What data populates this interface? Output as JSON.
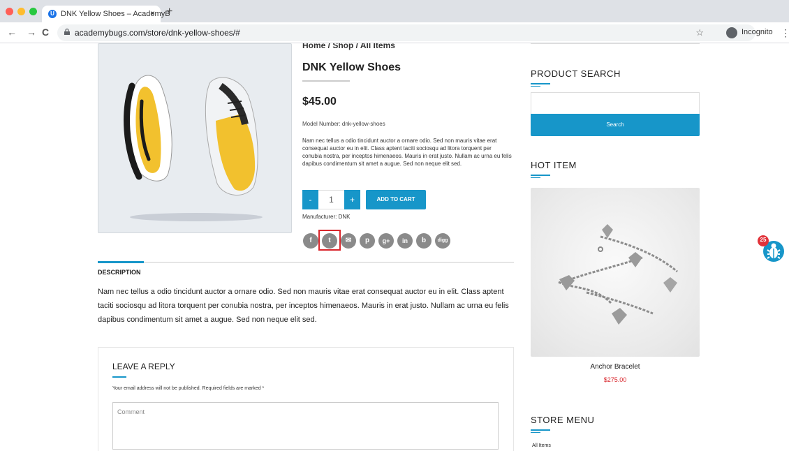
{
  "browser": {
    "tab_title": "DNK Yellow Shoes – AcademyB",
    "tab_close": "×",
    "new_tab": "+",
    "url": "academybugs.com/store/dnk-yellow-shoes/#",
    "incognito_label": "Incognito",
    "back": "←",
    "forward": "→",
    "reload": "C",
    "star": "☆",
    "menu": "⋮"
  },
  "product": {
    "breadcrumb": "Home / Shop / All Items",
    "title": "DNK Yellow Shoes",
    "price": "$45.00",
    "model": "Model Number: dnk-yellow-shoes",
    "short_description": "Nam nec tellus a odio tincidunt auctor a ornare odio. Sed non mauris vitae erat consequat auctor eu in elit. Class aptent taciti sociosqu ad litora torquent per conubia nostra, per inceptos himenaeos. Mauris in erat justo. Nullam ac urna eu felis dapibus condimentum sit amet a augue. Sed non neque elit sed.",
    "qty_minus": "-",
    "qty_value": "1",
    "qty_plus": "+",
    "add_to_cart": "ADD TO CART",
    "manufacturer": "Manufacturer: DNK",
    "share_icons": [
      {
        "name": "facebook-icon",
        "glyph": "f"
      },
      {
        "name": "twitter-icon",
        "glyph": "t"
      },
      {
        "name": "email-icon",
        "glyph": "✉"
      },
      {
        "name": "pinterest-icon",
        "glyph": "p"
      },
      {
        "name": "google-plus-icon",
        "glyph": "g+"
      },
      {
        "name": "linkedin-icon",
        "glyph": "in"
      },
      {
        "name": "buffer-icon",
        "glyph": "b"
      },
      {
        "name": "digg-icon",
        "glyph": "digg"
      }
    ]
  },
  "description": {
    "tab_label": "DESCRIPTION",
    "text": "Nam nec tellus a odio tincidunt auctor a ornare odio. Sed non mauris vitae erat consequat auctor eu in elit. Class aptent taciti sociosqu ad litora torquent per conubia nostra, per inceptos himenaeos. Mauris in erat justo. Nullam ac urna eu felis dapibus condimentum sit amet a augue. Sed non neque elit sed."
  },
  "reply": {
    "title": "LEAVE A REPLY",
    "note": "Your email address will not be published. Required fields are marked *",
    "comment_placeholder": "Comment"
  },
  "sidebar": {
    "search_title": "PRODUCT SEARCH",
    "search_button": "Search",
    "hot_title": "HOT ITEM",
    "hot_name": "Anchor Bracelet",
    "hot_price": "$275.00",
    "store_menu_title": "STORE MENU",
    "store_item": "All Items"
  },
  "bug_widget": {
    "count": "25"
  },
  "colors": {
    "accent": "#1796c9",
    "price_red": "#d9262c",
    "highlight": "#d9262c"
  }
}
